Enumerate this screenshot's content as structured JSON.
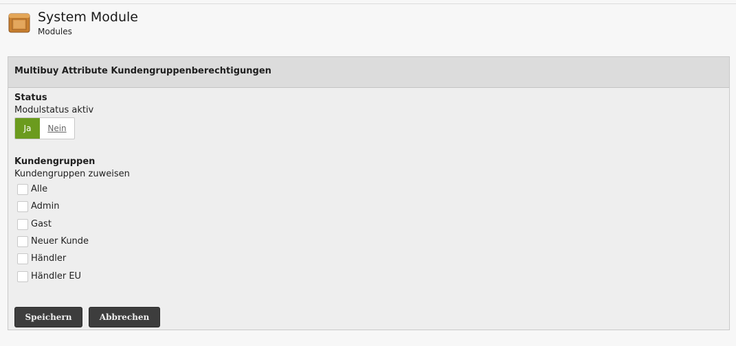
{
  "header": {
    "icon": "package-box-icon",
    "title": "System Module",
    "subtitle": "Modules"
  },
  "panel": {
    "title": "Multibuy Attribute Kundengruppenberechtigungen",
    "status": {
      "section_title": "Status",
      "field_label": "Modulstatus aktiv",
      "toggle_on": "Ja",
      "toggle_off": "Nein",
      "active": true
    },
    "groups": {
      "section_title": "Kundengruppen",
      "field_label": "Kundengruppen zuweisen",
      "items": [
        {
          "label": "Alle",
          "checked": false
        },
        {
          "label": "Admin",
          "checked": false
        },
        {
          "label": "Gast",
          "checked": false
        },
        {
          "label": "Neuer Kunde",
          "checked": false
        },
        {
          "label": "Händler",
          "checked": false
        },
        {
          "label": "Händler EU",
          "checked": false
        }
      ]
    },
    "buttons": {
      "save": "Speichern",
      "cancel": "Abbrechen"
    }
  },
  "colors": {
    "toggle_active": "#6b9b1e",
    "button_bg": "#3d3d3d",
    "panel_bg": "#eeeeee",
    "panel_header_bg": "#dcdcdc"
  }
}
